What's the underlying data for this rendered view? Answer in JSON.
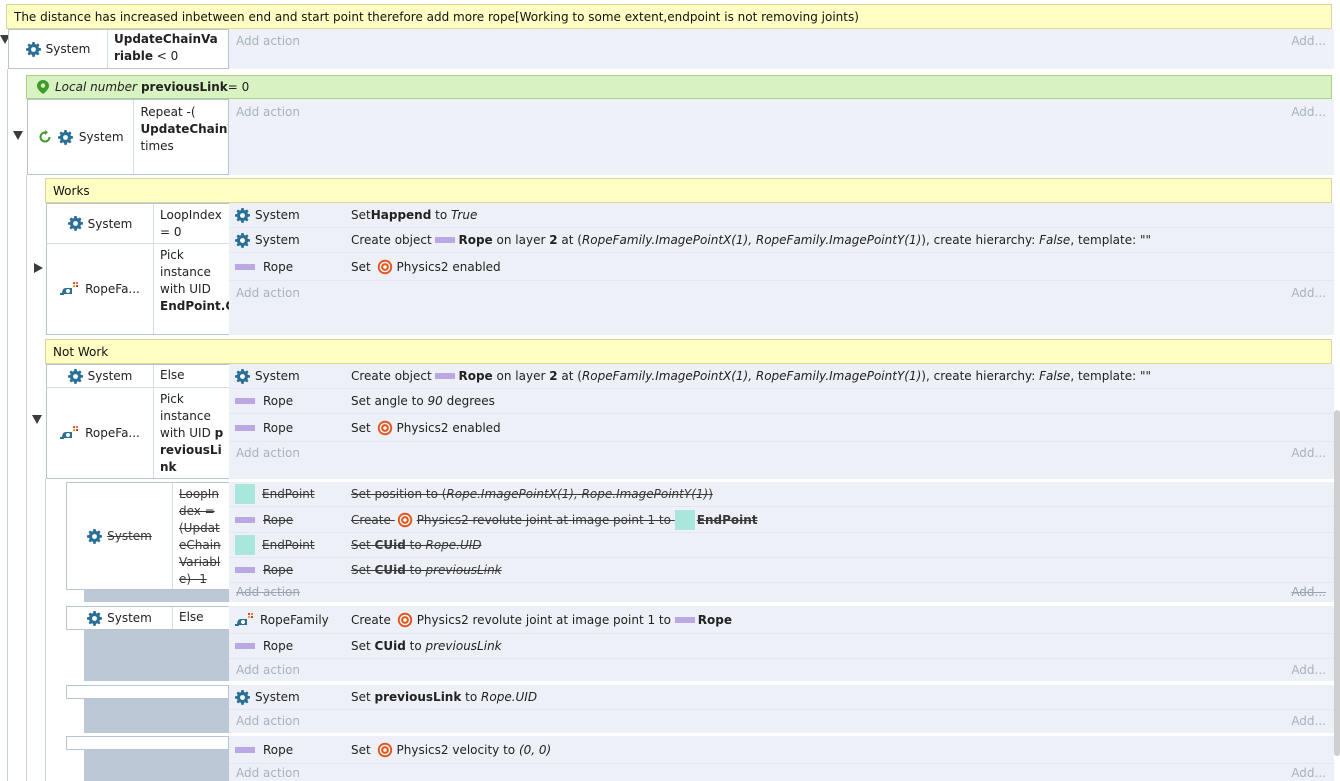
{
  "top_comment": "The distance has increased inbetween end and start point therefore add more rope[Working to some extent,endpoint is not removing joints)",
  "add_action": "Add action",
  "add_short": "Add...",
  "ev1": {
    "object": "System",
    "cond_bold": "UpdateChainVariable",
    "cond_rest": " < 0"
  },
  "local_var": {
    "prefix": "Local number",
    "name": "previousLink",
    "value": " = 0"
  },
  "ev2": {
    "object": "System",
    "cond_a": "Repeat -(",
    "cond_bold": "UpdateChainVariable)",
    "cond_b": "times"
  },
  "works_comment": "Works",
  "ev3": {
    "cond1": {
      "object": "System",
      "text": "LoopIndex = 0"
    },
    "cond2": {
      "object": "RopeFa...",
      "text": "Pick instance with UID ",
      "bold": "EndPoint.CUid"
    },
    "actions": [
      {
        "object": "System",
        "pre": "Set ",
        "bold": "Happend",
        "mid": " to ",
        "italic": "True"
      },
      {
        "object": "System",
        "pre": "Create object ",
        "rope": "Rope",
        "mid": " on layer ",
        "layer": "2",
        "post1": " at (",
        "italic1": "RopeFamily.ImagePointX(1), RopeFamily.ImagePointY(1)",
        "post2": "), create hierarchy: ",
        "italic2": "False",
        "post3": ", template: \"\""
      },
      {
        "object": "Rope",
        "pre": "Set ",
        "text": "Physics2 enabled"
      }
    ]
  },
  "notwork_comment": "Not Work",
  "ev4": {
    "cond1": {
      "object": "System",
      "text": "Else"
    },
    "cond2": {
      "object": "RopeFa...",
      "text": "Pick instance with UID ",
      "bold": "previousLink"
    },
    "actions": [
      {
        "object": "System",
        "pre": "Create object ",
        "rope": "Rope",
        "mid": " on layer ",
        "layer": "2",
        "post1": " at (",
        "italic1": "RopeFamily.ImagePointX(1), RopeFamily.ImagePointY(1)",
        "post2": "), create hierarchy: ",
        "italic2": "False",
        "post3": ", template: \"\""
      },
      {
        "object": "Rope",
        "pre": "Set angle to ",
        "italic": "90",
        "post": " degrees"
      },
      {
        "object": "Rope",
        "pre": "Set ",
        "text": "Physics2 enabled"
      }
    ]
  },
  "ev5": {
    "object": "System",
    "cond": "LoopIndex = (UpdateChainVariable) -1",
    "actions": [
      {
        "object": "EndPoint",
        "pre": "Set position to (",
        "italic": "Rope.ImagePointX(1), Rope.ImagePointY(1)",
        "post": ")"
      },
      {
        "object": "Rope",
        "pre": "Create ",
        "text": "Physics2 revolute joint at image point 1 to ",
        "bold": "EndPoint"
      },
      {
        "object": "EndPoint",
        "pre": "Set ",
        "bold": "CUid",
        "mid": " to ",
        "italic": "Rope.UID"
      },
      {
        "object": "Rope",
        "pre": "Set ",
        "bold": "CUid",
        "mid": " to ",
        "italic": "previousLink"
      }
    ]
  },
  "ev6": {
    "object": "System",
    "cond": "Else",
    "actions": [
      {
        "object": "RopeFamily",
        "pre": "Create ",
        "text": "Physics2 revolute joint at image point 1 to ",
        "rope": "Rope"
      },
      {
        "object": "Rope",
        "pre": "Set ",
        "bold": "CUid",
        "mid": " to ",
        "italic": "previousLink"
      }
    ]
  },
  "ev7": {
    "actions": [
      {
        "object": "System",
        "pre": "Set ",
        "bold": "previousLink",
        "mid": " to ",
        "italic": "Rope.UID"
      }
    ]
  },
  "ev8": {
    "actions": [
      {
        "object": "Rope",
        "pre": "Set ",
        "text": "Physics2 velocity to ",
        "italic": "(0, 0)"
      }
    ]
  },
  "colors": {
    "comment_bg": "#ffffc4",
    "local_bg": "#d9f2c1",
    "margin_bg": "#bdc8d7",
    "action_bg": "#edf1f7",
    "gear": "#2a6f96",
    "rope_chip": "#b9a8e4",
    "endpoint_chip": "#a9e6dc",
    "physics_icon": "#e2551f"
  }
}
